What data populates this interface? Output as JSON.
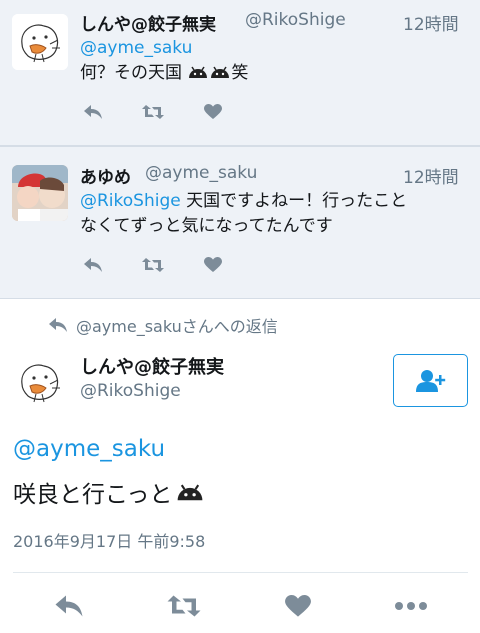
{
  "tweets": [
    {
      "name": "しんや@餃子無実",
      "handle": "@RikoShige",
      "time": "12時間",
      "mention": "@ayme_saku",
      "text": "何？その天国",
      "text_suffix": "笑"
    },
    {
      "name": "あゆめ",
      "handle": "@ayme_saku",
      "time": "12時間",
      "mention": "@RikoShige",
      "text_line1": " 天国ですよねー！行ったこと",
      "text_line2": "なくてずっと気になってたんです"
    }
  ],
  "reply_context": "@ayme_sakuさんへの返信",
  "main": {
    "name": "しんや@餃子無実",
    "handle": "@RikoShige",
    "mention": "@ayme_saku",
    "text": "咲良と行こっと",
    "timestamp": "2016年9月17日 午前9:58"
  },
  "colors": {
    "accent": "#1b95e0",
    "muted": "#657786",
    "background_highlight": "#eef2f7"
  },
  "icons": [
    "reply-icon",
    "retweet-icon",
    "like-icon",
    "more-icon",
    "follow-icon",
    "android-emoji-icon"
  ]
}
